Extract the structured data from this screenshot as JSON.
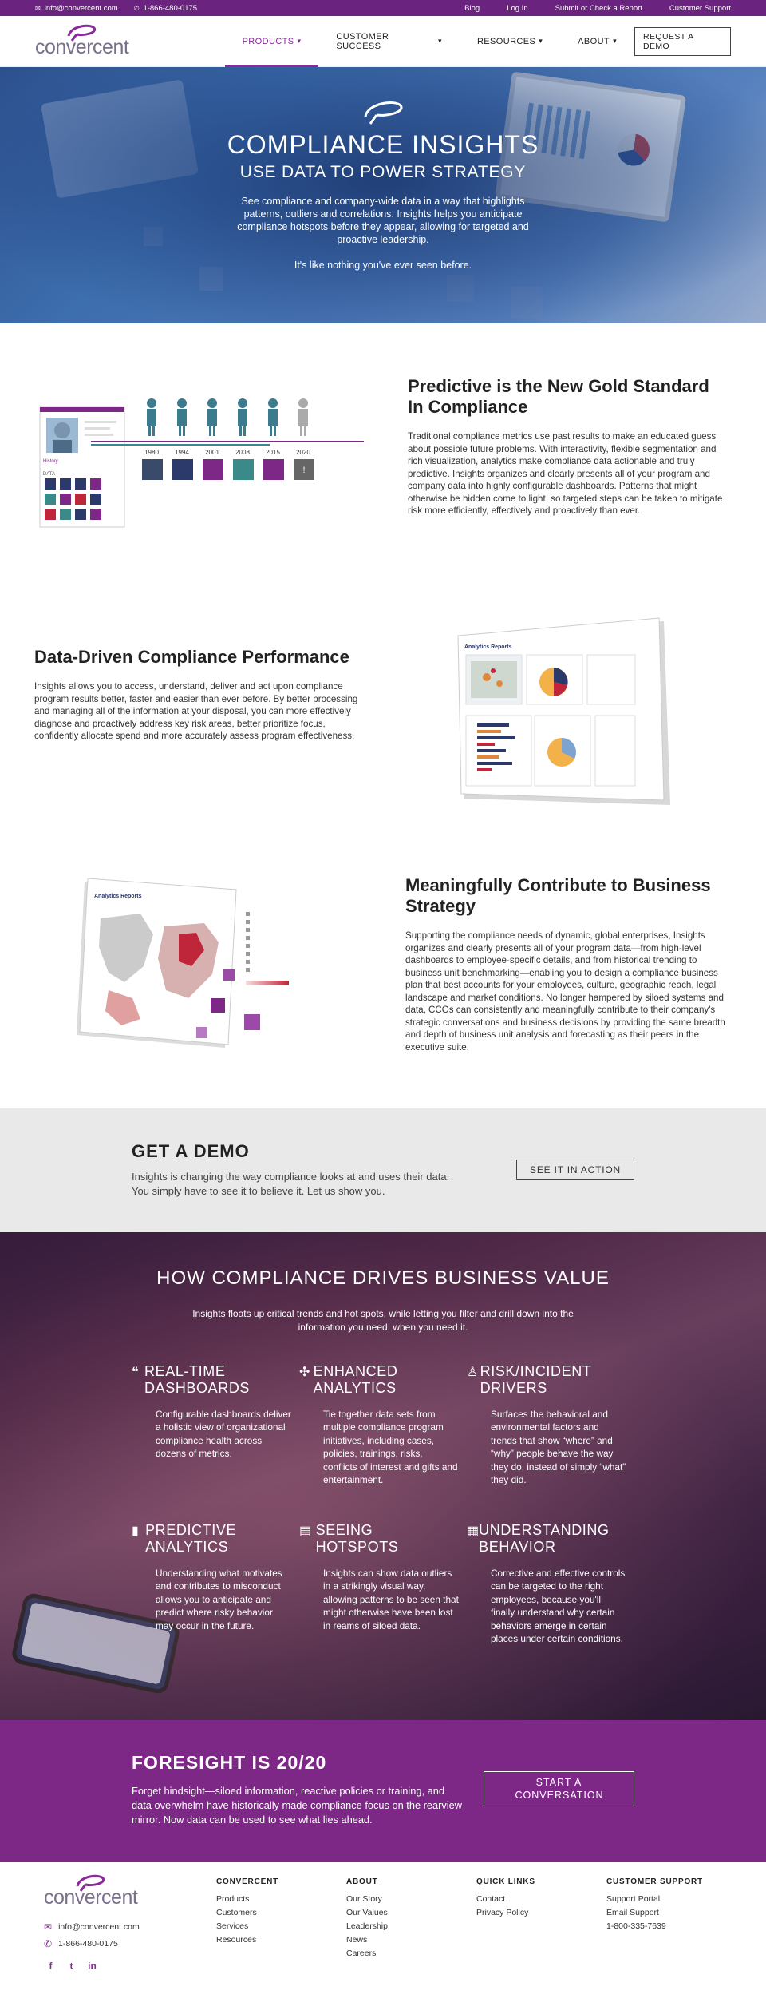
{
  "topbar": {
    "email": "info@convercent.com",
    "phone": "1-866-480-0175",
    "links": [
      "Blog",
      "Log In",
      "Submit or Check a Report",
      "Customer Support"
    ]
  },
  "nav": {
    "logo_text": "convercent",
    "items": [
      {
        "label": "PRODUCTS",
        "active": true
      },
      {
        "label": "CUSTOMER SUCCESS",
        "active": false
      },
      {
        "label": "RESOURCES",
        "active": false
      },
      {
        "label": "ABOUT",
        "active": false
      }
    ],
    "demo_button": "REQUEST A DEMO"
  },
  "hero": {
    "title": "COMPLIANCE INSIGHTS",
    "subtitle": "USE DATA TO POWER STRATEGY",
    "body": "See compliance and company-wide data in a way that highlights patterns, outliers and correlations. Insights helps you anticipate compliance hotspots before they appear, allowing for targeted and proactive leadership.",
    "tagline": "It's like nothing you've ever seen before."
  },
  "features": [
    {
      "title": "Predictive is the New Gold Standard In Compliance",
      "body": "Traditional compliance metrics use past results to make an educated guess about possible future problems. With interactivity, flexible segmentation and rich visualization, analytics make compliance data actionable and truly predictive. Insights organizes and clearly presents all of your program and company data into highly configurable dashboards. Patterns that might otherwise be hidden come to light, so targeted steps can be taken to mitigate risk more efficiently, effectively and proactively than ever."
    },
    {
      "title": "Data-Driven Compliance Performance",
      "body": "Insights allows you to access, understand, deliver and act upon compliance program results better, faster and easier than ever before. By better processing and managing all of the information at your disposal, you can more effectively diagnose and proactively address key risk areas, better prioritize focus, confidently allocate spend and more accurately assess program effectiveness."
    },
    {
      "title": "Meaningfully Contribute to Business Strategy",
      "body": "Supporting the compliance needs of dynamic, global enterprises, Insights organizes and clearly presents all of your program data—from high-level dashboards to employee-specific details, and from historical trending to business unit benchmarking—enabling you to design a compliance business plan that best accounts for your employees, culture, geographic reach, legal landscape and market conditions. No longer hampered by siloed systems and data, CCOs can consistently and meaningfully contribute to their company's strategic conversations and business decisions by providing the same breadth and depth of business unit analysis and forecasting as their peers in the executive suite."
    }
  ],
  "illustration1": {
    "years": [
      "1980",
      "1994",
      "2001",
      "2008",
      "2015",
      "2020"
    ],
    "history_label": "History",
    "data_label": "DATA"
  },
  "illustration2": {
    "title": "Analytics Reports"
  },
  "illustration3": {
    "title": "Analytics Reports"
  },
  "get_demo": {
    "title": "GET A DEMO",
    "body": "Insights is changing the way compliance looks at and uses their data. You simply have to see it to believe it. Let us show you.",
    "button": "SEE IT IN ACTION"
  },
  "value": {
    "title": "HOW COMPLIANCE DRIVES BUSINESS VALUE",
    "subtitle": "Insights floats up critical trends and hot spots, while letting you filter and drill down into the information you need, when you need it.",
    "items": [
      {
        "icon": "chat-bubbles-icon",
        "title": "REAL-TIME DASHBOARDS",
        "body": "Configurable dashboards deliver a holistic view of organizational compliance health across dozens of metrics."
      },
      {
        "icon": "network-icon",
        "title": "ENHANCED ANALYTICS",
        "body": "Tie together data sets from multiple compliance program initiatives, including cases, policies, trainings, risks, conflicts of interest and gifts and entertainment."
      },
      {
        "icon": "user-icon",
        "title": "RISK/INCIDENT DRIVERS",
        "body": "Surfaces the behavioral and environmental factors and trends that show “where” and “why” people behave the way they do, instead of simply “what” they did."
      },
      {
        "icon": "bar-chart-icon",
        "title": "PREDICTIVE ANALYTICS",
        "body": "Understanding what motivates and contributes to misconduct allows you to anticipate and predict where risky behavior may occur in the future."
      },
      {
        "icon": "document-icon",
        "title": "SEEING HOTSPOTS",
        "body": "Insights can show data outliers in a strikingly visual way, allowing patterns to be seen that might otherwise have been lost in reams of siloed data."
      },
      {
        "icon": "calculator-icon",
        "title": "UNDERSTANDING BEHAVIOR",
        "body": "Corrective and effective controls can be targeted to the right employees, because you'll finally understand why certain behaviors emerge in certain places under certain conditions."
      }
    ]
  },
  "foresight": {
    "title": "FORESIGHT IS 20/20",
    "body": "Forget hindsight—siloed information, reactive policies or training, and data overwhelm have historically made compliance focus on the rearview mirror. Now data can be used to see what lies ahead.",
    "button": "START A CONVERSATION"
  },
  "footer": {
    "logo_text": "convercent",
    "email": "info@convercent.com",
    "phone": "1-866-480-0175",
    "columns": [
      {
        "title": "CONVERCENT",
        "items": [
          "Products",
          "Customers",
          "Services",
          "Resources"
        ]
      },
      {
        "title": "ABOUT",
        "items": [
          "Our Story",
          "Our Values",
          "Leadership",
          "News",
          "Careers"
        ]
      },
      {
        "title": "QUICK LINKS",
        "items": [
          "Contact",
          "Privacy Policy"
        ]
      },
      {
        "title": "CUSTOMER SUPPORT",
        "items": [
          "Support Portal",
          "Email Support",
          "1-800-335-7639"
        ]
      }
    ],
    "social": [
      "facebook-icon",
      "twitter-icon",
      "linkedin-icon"
    ]
  },
  "colors": {
    "brand_purple": "#7d2787",
    "topbar": "#6b2380",
    "accent": "#8a2a9a"
  }
}
